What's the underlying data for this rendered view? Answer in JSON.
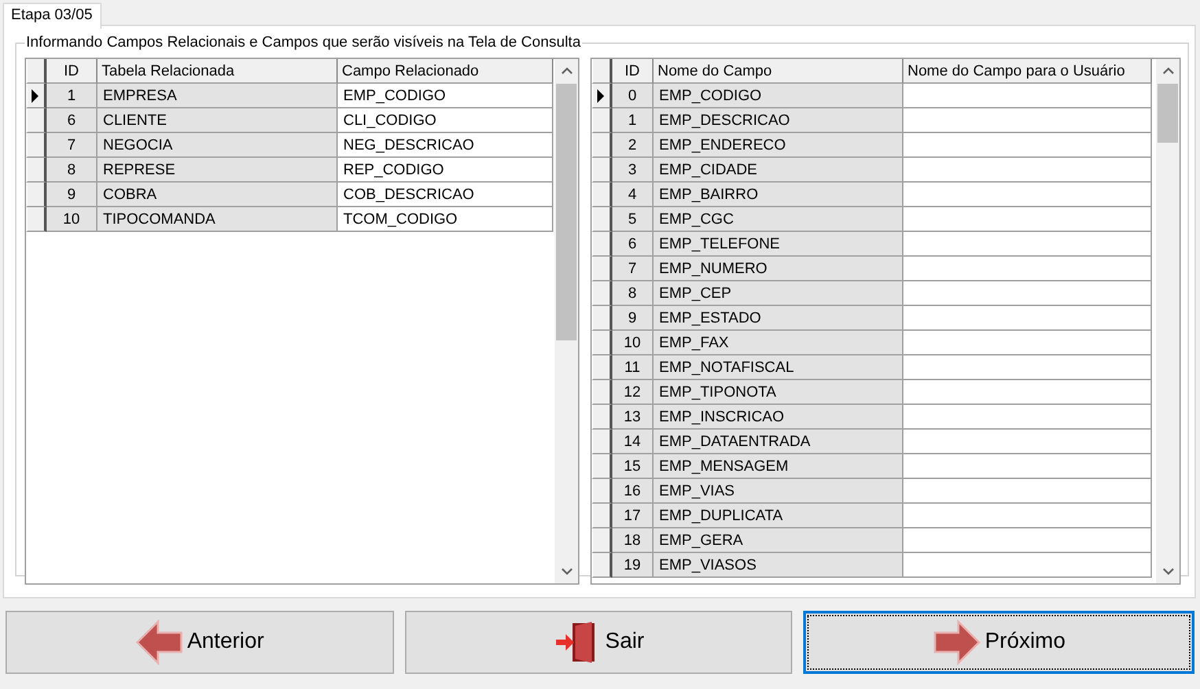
{
  "tab": {
    "label": "Etapa 03/05",
    "selected": true
  },
  "group": {
    "title": "Informando Campos Relacionais e Campos que serão visíveis na Tela de Consulta"
  },
  "grids": [
    {
      "kind": "short",
      "columns": [
        "ID",
        "Tabela Relacionada",
        "Campo Relacionado"
      ],
      "rows": [
        {
          "current": true,
          "cells": [
            "1",
            "EMPRESA",
            "EMP_CODIGO"
          ]
        },
        {
          "current": false,
          "cells": [
            "6",
            "CLIENTE",
            "CLI_CODIGO"
          ]
        },
        {
          "current": false,
          "cells": [
            "7",
            "NEGOCIA",
            "NEG_DESCRICAO"
          ]
        },
        {
          "current": false,
          "cells": [
            "8",
            "REPRESE",
            "REP_CODIGO"
          ]
        },
        {
          "current": false,
          "cells": [
            "9",
            "COBRA",
            "COB_DESCRICAO"
          ]
        },
        {
          "current": false,
          "cells": [
            "10",
            "TIPOCOMANDA",
            "TCOM_CODIGO"
          ]
        }
      ]
    },
    {
      "kind": "long",
      "columns": [
        "ID",
        "Nome do Campo",
        "Nome do Campo para o Usuário"
      ],
      "rows": [
        {
          "current": true,
          "cells": [
            "0",
            "EMP_CODIGO"
          ]
        },
        {
          "current": false,
          "cells": [
            "1",
            "EMP_DESCRICAO"
          ]
        },
        {
          "current": false,
          "cells": [
            "2",
            "EMP_ENDERECO"
          ]
        },
        {
          "current": false,
          "cells": [
            "3",
            "EMP_CIDADE"
          ]
        },
        {
          "current": false,
          "cells": [
            "4",
            "EMP_BAIRRO"
          ]
        },
        {
          "current": false,
          "cells": [
            "5",
            "EMP_CGC"
          ]
        },
        {
          "current": false,
          "cells": [
            "6",
            "EMP_TELEFONE"
          ]
        },
        {
          "current": false,
          "cells": [
            "7",
            "EMP_NUMERO"
          ]
        },
        {
          "current": false,
          "cells": [
            "8",
            "EMP_CEP"
          ]
        },
        {
          "current": false,
          "cells": [
            "9",
            "EMP_ESTADO"
          ]
        },
        {
          "current": false,
          "cells": [
            "10",
            "EMP_FAX"
          ]
        },
        {
          "current": false,
          "cells": [
            "11",
            "EMP_NOTAFISCAL"
          ]
        },
        {
          "current": false,
          "cells": [
            "12",
            "EMP_TIPONOTA"
          ]
        },
        {
          "current": false,
          "cells": [
            "13",
            "EMP_INSCRICAO"
          ]
        },
        {
          "current": false,
          "cells": [
            "14",
            "EMP_DATAENTRADA"
          ]
        },
        {
          "current": false,
          "cells": [
            "15",
            "EMP_MENSAGEM"
          ]
        },
        {
          "current": false,
          "cells": [
            "16",
            "EMP_VIAS"
          ]
        },
        {
          "current": false,
          "cells": [
            "17",
            "EMP_DUPLICATA"
          ]
        },
        {
          "current": false,
          "cells": [
            "18",
            "EMP_GERA"
          ]
        },
        {
          "current": false,
          "cells": [
            "19",
            "EMP_VIASOS"
          ]
        }
      ]
    }
  ],
  "buttons": [
    {
      "label": "Anterior",
      "kind": "back",
      "focused": false
    },
    {
      "label": "Sair",
      "kind": "exit",
      "focused": false
    },
    {
      "label": "Próximo",
      "kind": "next",
      "focused": true
    }
  ]
}
